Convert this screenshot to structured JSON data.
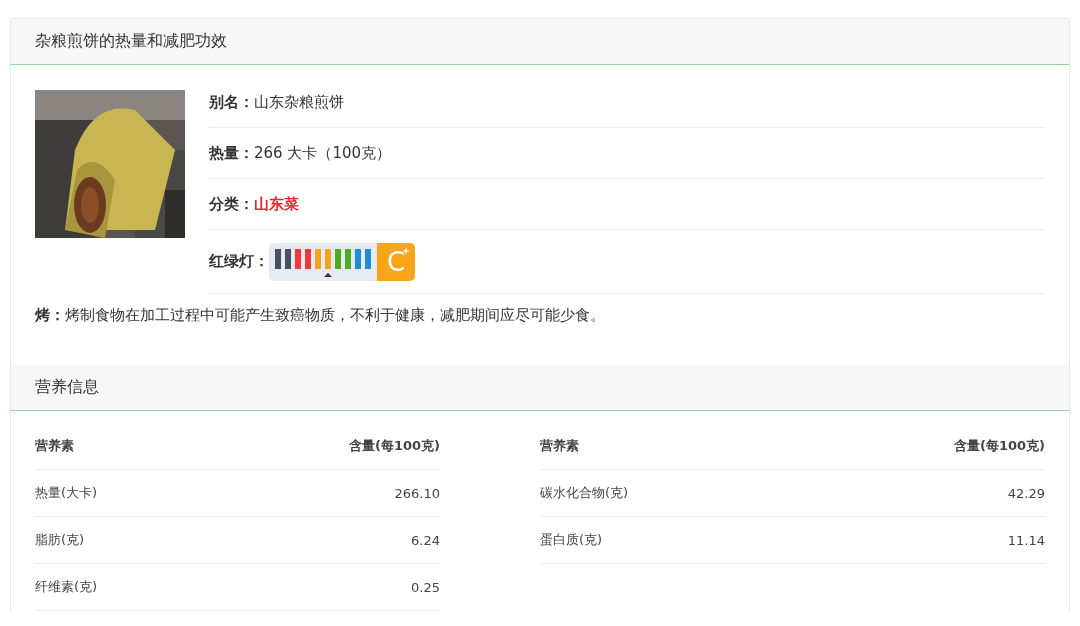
{
  "section_title": "杂粮煎饼的热量和减肥功效",
  "info": [
    {
      "kind": "text",
      "label": "别名：",
      "value": "山东杂粮煎饼"
    },
    {
      "kind": "text",
      "label": "热量：",
      "value": "266 大卡（100克）"
    },
    {
      "kind": "category",
      "label": "分类：",
      "value": "山东菜"
    },
    {
      "kind": "lights",
      "label": "红绿灯：",
      "grade": "C",
      "bars": [
        {
          "color": "#4a4f63",
          "selected": false
        },
        {
          "color": "#4a4f63",
          "selected": false
        },
        {
          "color": "#f03a3a",
          "selected": false
        },
        {
          "color": "#f03a3a",
          "selected": false
        },
        {
          "color": "#f5a31a",
          "selected": false
        },
        {
          "color": "#f5a31a",
          "selected": true
        },
        {
          "color": "#52a820",
          "selected": false
        },
        {
          "color": "#52a820",
          "selected": false
        },
        {
          "color": "#1a8fd8",
          "selected": false
        },
        {
          "color": "#1a8fd8",
          "selected": false
        }
      ]
    }
  ],
  "note": {
    "label": "烤：",
    "text": "烤制食物在加工过程中可能产生致癌物质，不利于健康，减肥期间应尽可能少食。"
  },
  "nutrition_title": "营养信息",
  "table": {
    "columns": [
      "营养素",
      "含量(每100克)",
      "营养素",
      "含量(每100克)"
    ],
    "rows": [
      [
        "热量(大卡)",
        "266.10",
        "碳水化合物(克)",
        "42.29"
      ],
      [
        "脂肪(克)",
        "6.24",
        "蛋白质(克)",
        "11.14"
      ],
      [
        "纤维素(克)",
        "0.25"
      ]
    ]
  }
}
